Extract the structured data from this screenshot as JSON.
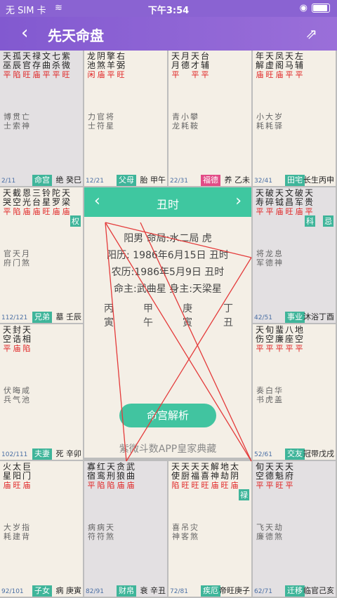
{
  "status": {
    "carrier": "无 SIM 卡",
    "time": "下午3:54"
  },
  "nav": {
    "title": "先天命盘"
  },
  "cells": {
    "si": {
      "stars": [
        [
          "天",
          "平"
        ],
        [
          "孤",
          "陷"
        ],
        [
          "天",
          "旺"
        ],
        [
          "禄",
          "庙"
        ],
        [
          "文",
          "平"
        ],
        [
          "七",
          "平"
        ],
        [
          "紫",
          "旺"
        ]
      ],
      "stars2": [
        [
          "巫",
          ""
        ],
        [
          "辰",
          ""
        ],
        [
          "官",
          ""
        ],
        [
          "存",
          ""
        ],
        [
          "曲",
          ""
        ],
        [
          "杀",
          ""
        ],
        [
          "微",
          ""
        ]
      ],
      "minor": [
        "博",
        "贯",
        "亡",
        "士",
        "索",
        "神"
      ],
      "range": "2/11",
      "palace": "命宫",
      "right": "绝  癸巳"
    },
    "wu": {
      "stars": [
        [
          "龙",
          "闲"
        ],
        [
          "阴",
          "庙"
        ],
        [
          "擎",
          "平"
        ],
        [
          "右",
          "旺"
        ]
      ],
      "stars2": [
        [
          "池",
          ""
        ],
        [
          "煞",
          ""
        ],
        [
          "羊",
          ""
        ],
        [
          "弼",
          ""
        ]
      ],
      "minor": [
        "力",
        "官",
        "将",
        "士",
        "符",
        "星"
      ],
      "range": "12/21",
      "palace": "父母",
      "right": "胎  甲午"
    },
    "wei": {
      "stars": [
        [
          "天",
          "平"
        ],
        [
          "月",
          ""
        ],
        [
          "天",
          "平"
        ],
        [
          "台",
          "平"
        ]
      ],
      "stars2": [
        [
          "月",
          ""
        ],
        [
          "德",
          ""
        ],
        [
          "才",
          ""
        ],
        [
          "辅",
          ""
        ]
      ],
      "minor": [
        "青",
        "小",
        "攀",
        "龙",
        "耗",
        "鞍"
      ],
      "range": "22/31",
      "palace": "福德",
      "right": "养  乙未"
    },
    "shen": {
      "stars": [
        [
          "年",
          "庙"
        ],
        [
          "天",
          "旺"
        ],
        [
          "凤",
          "庙"
        ],
        [
          "天",
          "平"
        ],
        [
          "左",
          "平"
        ]
      ],
      "stars2": [
        [
          "解",
          ""
        ],
        [
          "虚",
          ""
        ],
        [
          "阁",
          ""
        ],
        [
          "马",
          ""
        ],
        [
          "辅",
          ""
        ]
      ],
      "minor": [
        "小",
        "大",
        "岁",
        "耗",
        "耗",
        "驿"
      ],
      "range": "32/41",
      "palace": "田宅",
      "right": "长生丙申"
    },
    "chen": {
      "stars": [
        [
          "天",
          "平"
        ],
        [
          "截",
          "陷"
        ],
        [
          "恩",
          "庙"
        ],
        [
          "三",
          "庙"
        ],
        [
          "铃",
          "旺"
        ],
        [
          "陀",
          "庙"
        ],
        [
          "天",
          "庙"
        ]
      ],
      "stars2": [
        [
          "哭",
          ""
        ],
        [
          "空",
          ""
        ],
        [
          "光",
          ""
        ],
        [
          "台",
          ""
        ],
        [
          "星",
          ""
        ],
        [
          "罗",
          ""
        ],
        [
          "梁",
          ""
        ]
      ],
      "minor": [
        "官",
        "天",
        "月",
        "府",
        "门",
        "煞"
      ],
      "range": "112/121",
      "palace": "兄弟",
      "right": "墓  壬辰"
    },
    "you": {
      "stars": [
        [
          "天",
          "平"
        ],
        [
          "破",
          "平"
        ],
        [
          "天",
          "庙"
        ],
        [
          "文",
          "旺"
        ],
        [
          "破",
          "庙"
        ],
        [
          "天",
          "平"
        ]
      ],
      "stars2": [
        [
          "寿",
          ""
        ],
        [
          "碎",
          ""
        ],
        [
          "钺",
          ""
        ],
        [
          "昌",
          ""
        ],
        [
          "军",
          ""
        ],
        [
          "贵",
          ""
        ]
      ],
      "minor": [
        "将",
        "龙",
        "息",
        "军",
        "德",
        "神"
      ],
      "range": "42/51",
      "palace": "事业",
      "right": "沐浴丁酉"
    },
    "mao": {
      "stars": [
        [
          "天",
          "平"
        ],
        [
          "封",
          "庙"
        ],
        [
          "天",
          "陷"
        ]
      ],
      "stars2": [
        [
          "空",
          ""
        ],
        [
          "诰",
          ""
        ],
        [
          "相",
          ""
        ]
      ],
      "minor": [
        "伏",
        "晦",
        "咸",
        "兵",
        "气",
        "池"
      ],
      "range": "102/111",
      "palace": "夫妻",
      "right": "死  辛卯"
    },
    "xu": {
      "stars": [
        [
          "天",
          "平"
        ],
        [
          "旬",
          "平"
        ],
        [
          "蜚",
          "平"
        ],
        [
          "八",
          "平"
        ],
        [
          "地",
          "平"
        ]
      ],
      "stars2": [
        [
          "伤",
          ""
        ],
        [
          "空",
          ""
        ],
        [
          "廉",
          ""
        ],
        [
          "座",
          ""
        ],
        [
          "空",
          ""
        ]
      ],
      "minor": [
        "奏",
        "白",
        "华",
        "书",
        "虎",
        "盖"
      ],
      "range": "52/61",
      "palace": "交友",
      "right": "冠带戊戌"
    },
    "yin": {
      "stars": [
        [
          "火",
          "庙"
        ],
        [
          "太",
          "旺"
        ],
        [
          "巨",
          "庙"
        ]
      ],
      "stars2": [
        [
          "星",
          ""
        ],
        [
          "阳",
          ""
        ],
        [
          "门",
          ""
        ]
      ],
      "minor": [
        "大",
        "岁",
        "指",
        "耗",
        "建",
        "背"
      ],
      "range": "92/101",
      "palace": "子女",
      "right": "病  庚寅"
    },
    "chou": {
      "stars": [
        [
          "寡",
          "平"
        ],
        [
          "红",
          "陷"
        ],
        [
          "天",
          "陷"
        ],
        [
          "贪",
          "庙"
        ],
        [
          "武",
          "庙"
        ]
      ],
      "stars2": [
        [
          "宿",
          ""
        ],
        [
          "鸾",
          ""
        ],
        [
          "刑",
          ""
        ],
        [
          "狼",
          ""
        ],
        [
          "曲",
          ""
        ]
      ],
      "minor": [
        "病",
        "病",
        "天",
        "符",
        "符",
        "煞"
      ],
      "range": "82/91",
      "palace": "财帛",
      "right": "衰  辛丑"
    },
    "zi": {
      "stars": [
        [
          "天",
          "陷"
        ],
        [
          "天",
          "旺"
        ],
        [
          "天",
          "旺"
        ],
        [
          "天",
          "旺"
        ],
        [
          "解",
          "庙"
        ],
        [
          "地",
          "旺"
        ],
        [
          "太",
          "庙"
        ]
      ],
      "stars2": [
        [
          "使",
          ""
        ],
        [
          "厨",
          ""
        ],
        [
          "福",
          ""
        ],
        [
          "喜",
          ""
        ],
        [
          "神",
          ""
        ],
        [
          "劫",
          ""
        ],
        [
          "阴",
          ""
        ]
      ],
      "minor": [
        "喜",
        "吊",
        "灾",
        "神",
        "客",
        "煞"
      ],
      "range": "72/81",
      "palace": "疾厄",
      "right": "帝旺庚子"
    },
    "hai": {
      "stars": [
        [
          "旬",
          "平"
        ],
        [
          "天",
          "平"
        ],
        [
          "天",
          "旺"
        ],
        [
          "天",
          "平"
        ]
      ],
      "stars2": [
        [
          "空",
          ""
        ],
        [
          "德",
          ""
        ],
        [
          "魁",
          ""
        ],
        [
          "府",
          ""
        ]
      ],
      "minor": [
        "飞",
        "天",
        "劫",
        "廉",
        "德",
        "煞"
      ],
      "range": "62/71",
      "palace": "迁移",
      "right": "临官己亥"
    }
  },
  "badges": {
    "chen": "权",
    "you_a": "科",
    "you_b": "忌",
    "zi": "禄"
  },
  "center": {
    "hour": "丑时",
    "line1": "阳男  命局:水二局 虎",
    "line2": "阳历: 1986年6月15日 丑时",
    "line3": "农历:1986年5月9日 丑时",
    "line4": "命主:武曲星  身主:天梁星",
    "gan": [
      "丙",
      "甲",
      "庚",
      "丁"
    ],
    "zhi": [
      "寅",
      "午",
      "寅",
      "丑"
    ],
    "button": "命宫解析",
    "watermark": "紫微斗数APP皇家典藏"
  }
}
